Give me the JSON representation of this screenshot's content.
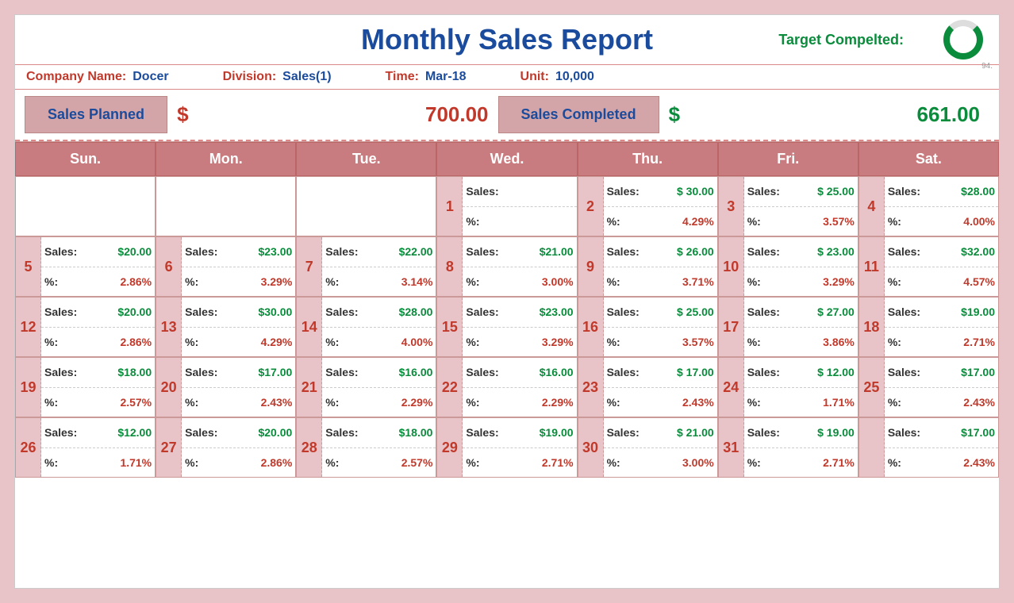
{
  "title": "Monthly Sales Report",
  "target_label": "Target Compelted:",
  "target_pct": "94.",
  "info": {
    "company_lbl": "Company Name:",
    "company": "Docer",
    "division_lbl": "Division:",
    "division": "Sales(1)",
    "time_lbl": "Time:",
    "time": "Mar-18",
    "unit_lbl": "Unit:",
    "unit": "10,000"
  },
  "totals": {
    "planned_lbl": "Sales Planned",
    "planned_cur": "$",
    "planned_val": "700.00",
    "completed_lbl": "Sales Completed",
    "completed_cur": "$",
    "completed_val": "661.00"
  },
  "days": [
    "Sun.",
    "Mon.",
    "Tue.",
    "Wed.",
    "Thu.",
    "Fri.",
    "Sat."
  ],
  "labels": {
    "sales": "Sales:",
    "pct": "%:"
  },
  "cells": [
    {
      "num": "",
      "sales": "",
      "pct": ""
    },
    {
      "num": "",
      "sales": "",
      "pct": ""
    },
    {
      "num": "",
      "sales": "",
      "pct": ""
    },
    {
      "num": "1",
      "sales": "",
      "pct": ""
    },
    {
      "num": "2",
      "sales": "$ 30.00",
      "pct": "4.29%"
    },
    {
      "num": "3",
      "sales": "$   25.00",
      "pct": "3.57%"
    },
    {
      "num": "4",
      "sales": "$28.00",
      "pct": "4.00%"
    },
    {
      "num": "5",
      "sales": "$20.00",
      "pct": "2.86%"
    },
    {
      "num": "6",
      "sales": "$23.00",
      "pct": "3.29%"
    },
    {
      "num": "7",
      "sales": "$22.00",
      "pct": "3.14%"
    },
    {
      "num": "8",
      "sales": "$21.00",
      "pct": "3.00%"
    },
    {
      "num": "9",
      "sales": "$ 26.00",
      "pct": "3.71%"
    },
    {
      "num": "10",
      "sales": "$   23.00",
      "pct": "3.29%"
    },
    {
      "num": "11",
      "sales": "$32.00",
      "pct": "4.57%"
    },
    {
      "num": "12",
      "sales": "$20.00",
      "pct": "2.86%"
    },
    {
      "num": "13",
      "sales": "$30.00",
      "pct": "4.29%"
    },
    {
      "num": "14",
      "sales": "$28.00",
      "pct": "4.00%"
    },
    {
      "num": "15",
      "sales": "$23.00",
      "pct": "3.29%"
    },
    {
      "num": "16",
      "sales": "$ 25.00",
      "pct": "3.57%"
    },
    {
      "num": "17",
      "sales": "$   27.00",
      "pct": "3.86%"
    },
    {
      "num": "18",
      "sales": "$19.00",
      "pct": "2.71%"
    },
    {
      "num": "19",
      "sales": "$18.00",
      "pct": "2.57%"
    },
    {
      "num": "20",
      "sales": "$17.00",
      "pct": "2.43%"
    },
    {
      "num": "21",
      "sales": "$16.00",
      "pct": "2.29%"
    },
    {
      "num": "22",
      "sales": "$16.00",
      "pct": "2.29%"
    },
    {
      "num": "23",
      "sales": "$ 17.00",
      "pct": "2.43%"
    },
    {
      "num": "24",
      "sales": "$   12.00",
      "pct": "1.71%"
    },
    {
      "num": "25",
      "sales": "$17.00",
      "pct": "2.43%"
    },
    {
      "num": "26",
      "sales": "$12.00",
      "pct": "1.71%"
    },
    {
      "num": "27",
      "sales": "$20.00",
      "pct": "2.86%"
    },
    {
      "num": "28",
      "sales": "$18.00",
      "pct": "2.57%"
    },
    {
      "num": "29",
      "sales": "$19.00",
      "pct": "2.71%"
    },
    {
      "num": "30",
      "sales": "$ 21.00",
      "pct": "3.00%"
    },
    {
      "num": "31",
      "sales": "$   19.00",
      "pct": "2.71%"
    },
    {
      "num": "",
      "sales": "$17.00",
      "pct": "2.43%"
    }
  ]
}
